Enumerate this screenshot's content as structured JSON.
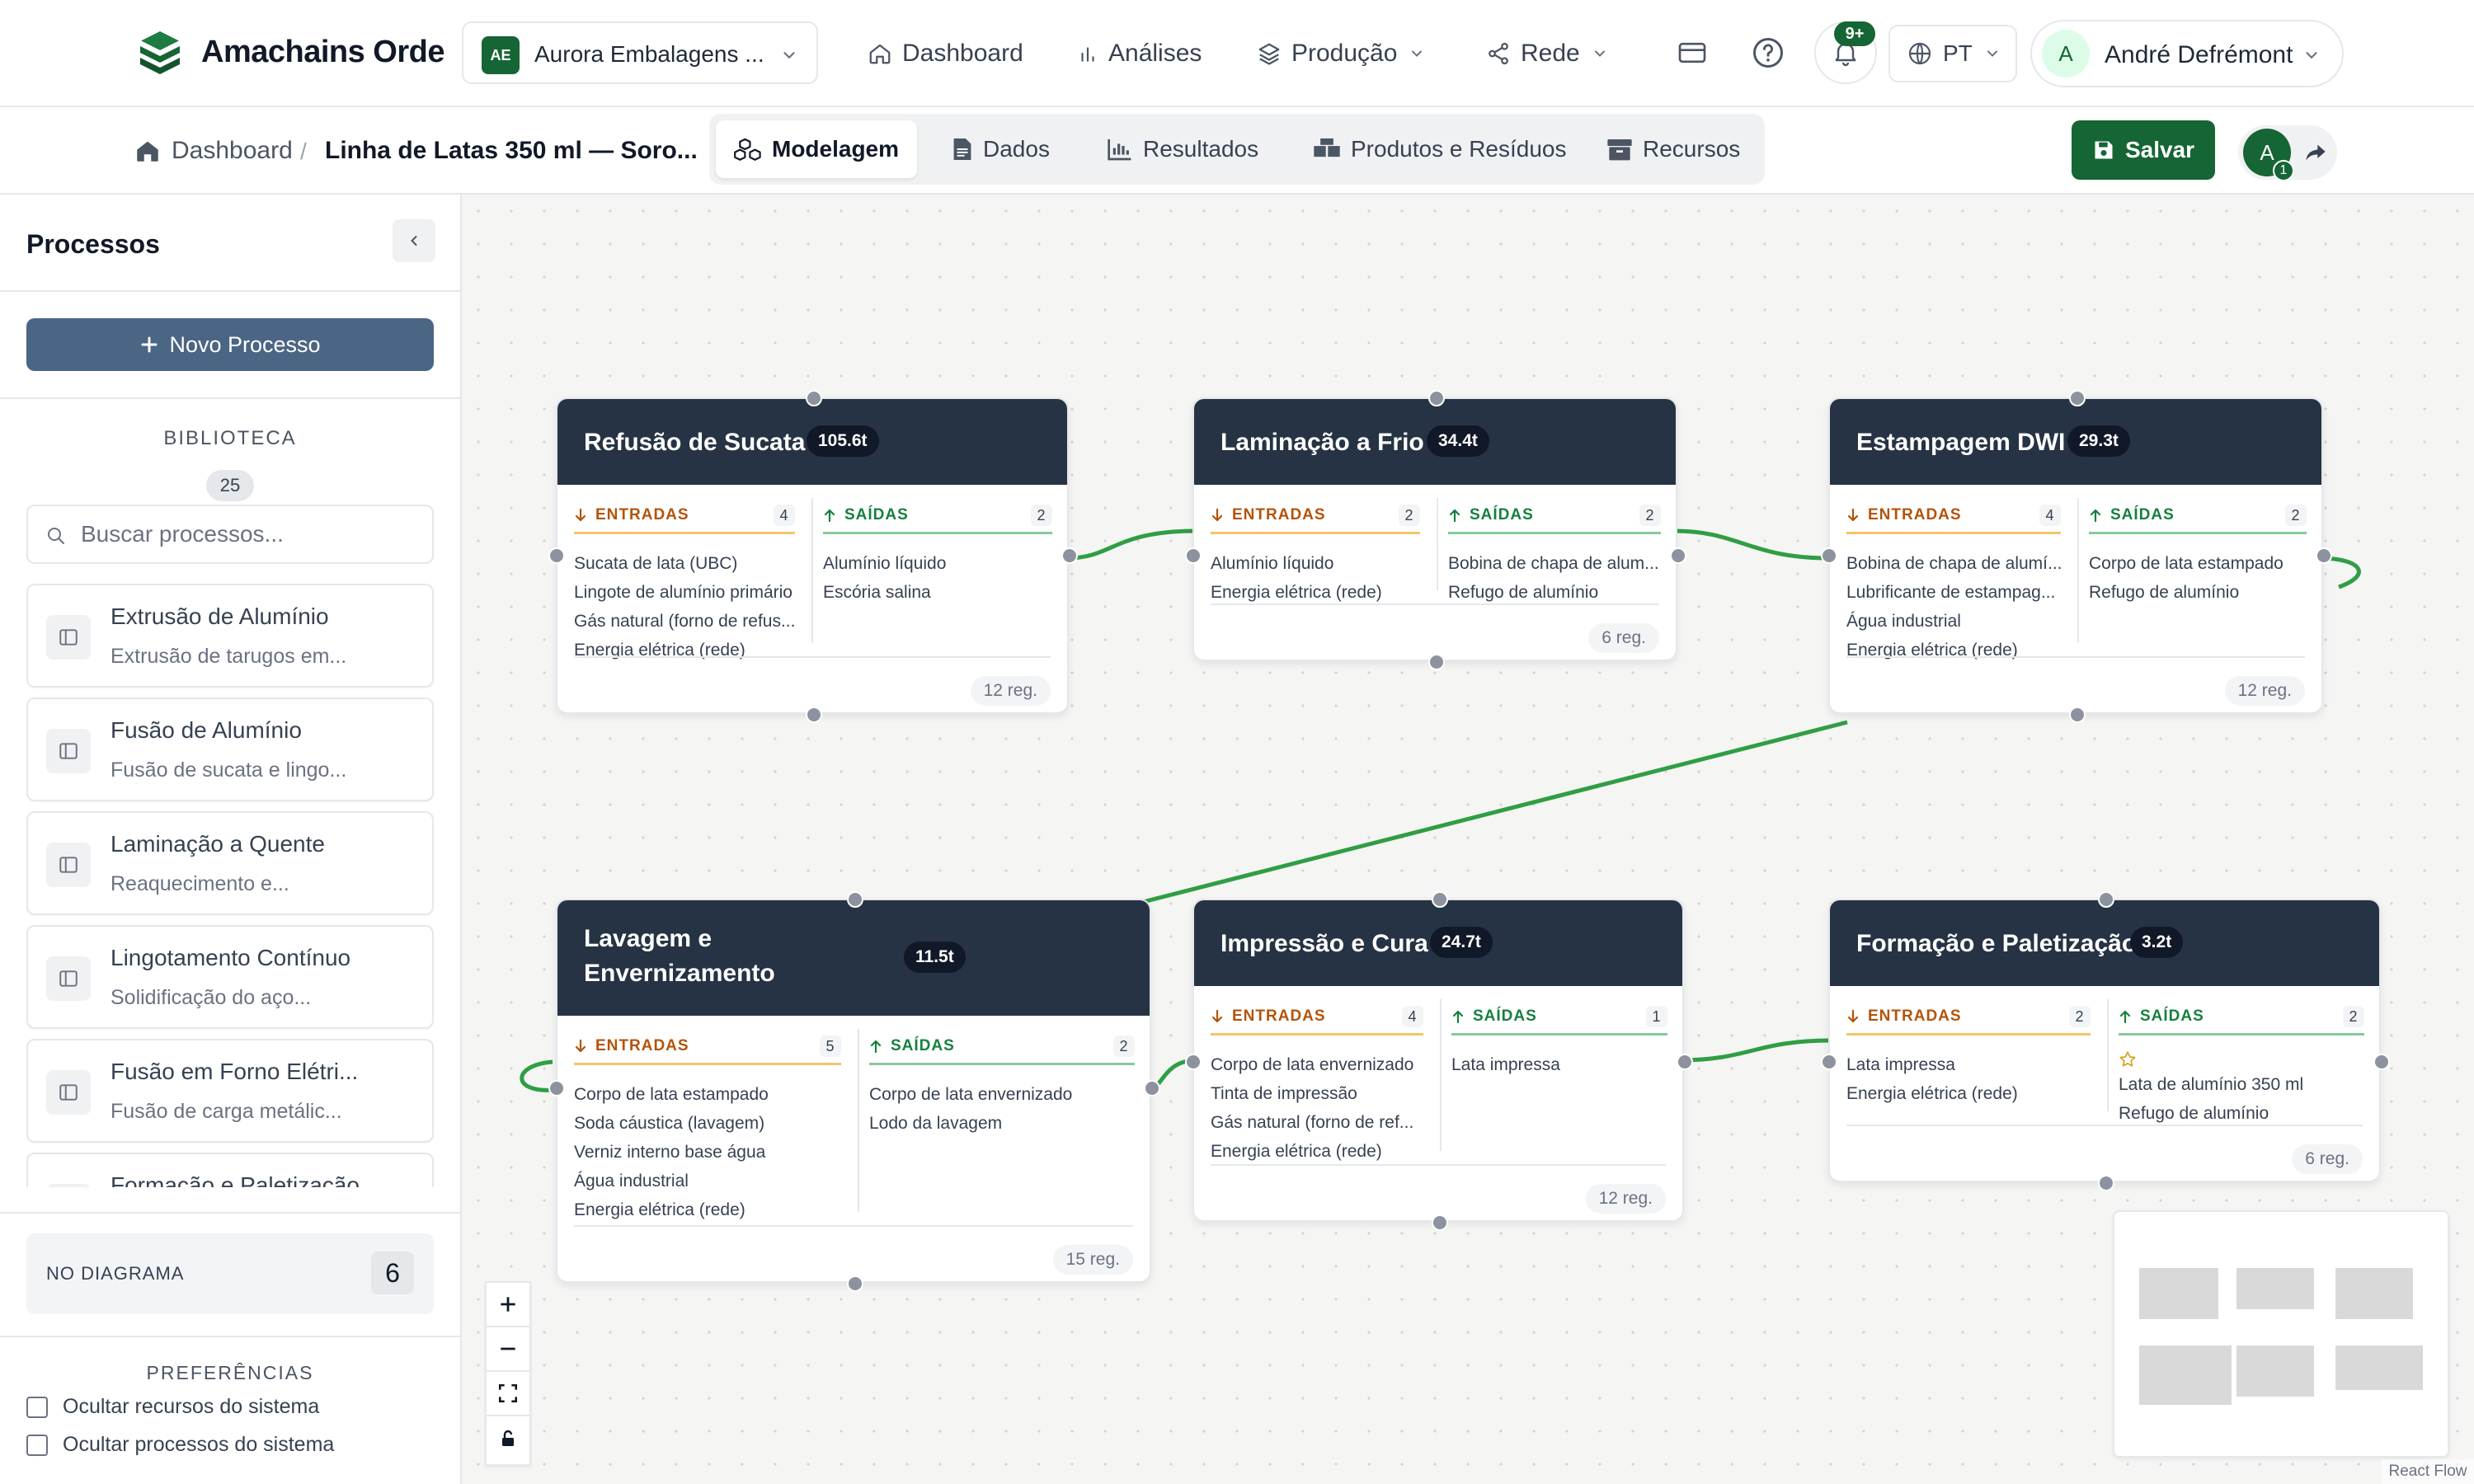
{
  "app": {
    "brand": "Amachains Orde"
  },
  "header": {
    "org_initials": "AE",
    "org_name": "Aurora Embalagens ...",
    "nav": [
      {
        "label": "Dashboard",
        "icon": "home-icon"
      },
      {
        "label": "Análises",
        "icon": "bar-chart-icon"
      },
      {
        "label": "Produção",
        "icon": "layers-icon"
      },
      {
        "label": "Rede",
        "icon": "share-network-icon"
      }
    ],
    "notif_badge": "9+",
    "lang": "PT",
    "user_initial": "A",
    "user_name": "André Defrémont"
  },
  "subbar": {
    "crumb_home": "Dashboard",
    "crumb_sep": "/",
    "crumb_current": "Linha de Latas 350 ml — Soro...",
    "tabs": [
      {
        "label": "Modelagem",
        "icon": "cubes-icon",
        "active": true
      },
      {
        "label": "Dados",
        "icon": "document-icon"
      },
      {
        "label": "Resultados",
        "icon": "chart-icon"
      },
      {
        "label": "Produtos e Resíduos",
        "icon": "boxes-icon"
      },
      {
        "label": "Recursos",
        "icon": "archive-icon"
      }
    ],
    "save_label": "Salvar",
    "collab_initial": "A",
    "collab_count": "1"
  },
  "sidebar": {
    "title": "Processos",
    "new_process": "Novo Processo",
    "library_label": "BIBLIOTECA",
    "library_count": "25",
    "search_placeholder": "Buscar processos...",
    "library": [
      {
        "title": "Extrusão de Alumínio",
        "desc": "Extrusão de tarugos em..."
      },
      {
        "title": "Fusão de Alumínio",
        "desc": "Fusão de sucata e lingo..."
      },
      {
        "title": "Laminação a Quente",
        "desc": "Reaquecimento e..."
      },
      {
        "title": "Lingotamento Contínuo",
        "desc": "Solidificação do aço..."
      },
      {
        "title": "Fusão em Forno Elétri...",
        "desc": "Fusão de carga metálic..."
      },
      {
        "title": "Formação e Paletização",
        "desc": ""
      }
    ],
    "in_diagram_label": "NO DIAGRAMA",
    "in_diagram_count": "6",
    "preferences_label": "PREFERÊNCIAS",
    "prefs": [
      "Ocultar recursos do sistema",
      "Ocultar processos do sistema"
    ]
  },
  "nodes": [
    {
      "title": "Refusão de Sucata",
      "weight": "105.6t",
      "in_label": "ENTRADAS",
      "in_count": "4",
      "inputs": [
        "Sucata de lata (UBC)",
        "Lingote de alumínio primário",
        "Gás natural (forno de refus...",
        "Energia elétrica (rede)"
      ],
      "out_label": "SAÍDAS",
      "out_count": "2",
      "outputs": [
        "Alumínio líquido",
        "Escória salina"
      ],
      "records": "12 reg."
    },
    {
      "title": "Laminação a Frio",
      "weight": "34.4t",
      "in_label": "ENTRADAS",
      "in_count": "2",
      "inputs": [
        "Alumínio líquido",
        "Energia elétrica (rede)"
      ],
      "out_label": "SAÍDAS",
      "out_count": "2",
      "outputs": [
        "Bobina de chapa de alum...",
        "Refugo de alumínio"
      ],
      "records": "6 reg."
    },
    {
      "title": "Estampagem DWI",
      "weight": "29.3t",
      "in_label": "ENTRADAS",
      "in_count": "4",
      "inputs": [
        "Bobina de chapa de alumí...",
        "Lubrificante de estampag...",
        "Água industrial",
        "Energia elétrica (rede)"
      ],
      "out_label": "SAÍDAS",
      "out_count": "2",
      "outputs": [
        "Corpo de lata estampado",
        "Refugo de alumínio"
      ],
      "records": "12 reg."
    },
    {
      "title_l1": "Lavagem e",
      "title_l2": "Envernizamento",
      "weight": "11.5t",
      "in_label": "ENTRADAS",
      "in_count": "5",
      "inputs": [
        "Corpo de lata estampado",
        "Soda cáustica (lavagem)",
        "Verniz interno base água",
        "Água industrial",
        "Energia elétrica (rede)"
      ],
      "out_label": "SAÍDAS",
      "out_count": "2",
      "outputs": [
        "Corpo de lata envernizado",
        "Lodo da lavagem"
      ],
      "records": "15 reg."
    },
    {
      "title": "Impressão e Cura",
      "weight": "24.7t",
      "in_label": "ENTRADAS",
      "in_count": "4",
      "inputs": [
        "Corpo de lata envernizado",
        "Tinta de impressão",
        "Gás natural (forno de ref...",
        "Energia elétrica (rede)"
      ],
      "out_label": "SAÍDAS",
      "out_count": "1",
      "outputs": [
        "Lata impressa"
      ],
      "records": "12 reg."
    },
    {
      "title": "Formação e Paletização",
      "weight": "3.2t",
      "in_label": "ENTRADAS",
      "in_count": "2",
      "inputs": [
        "Lata impressa",
        "Energia elétrica (rede)"
      ],
      "out_label": "SAÍDAS",
      "out_count": "2",
      "outputs": [
        "Lata de alumínio 350 ml",
        "Refugo de alumínio"
      ],
      "records": "6 reg."
    }
  ],
  "attribution": "React Flow",
  "colors": {
    "brand": "#166534",
    "node_header": "#263344",
    "edge": "#2f9e44",
    "inputs_accent": "#b45309",
    "outputs_accent": "#15803d"
  }
}
